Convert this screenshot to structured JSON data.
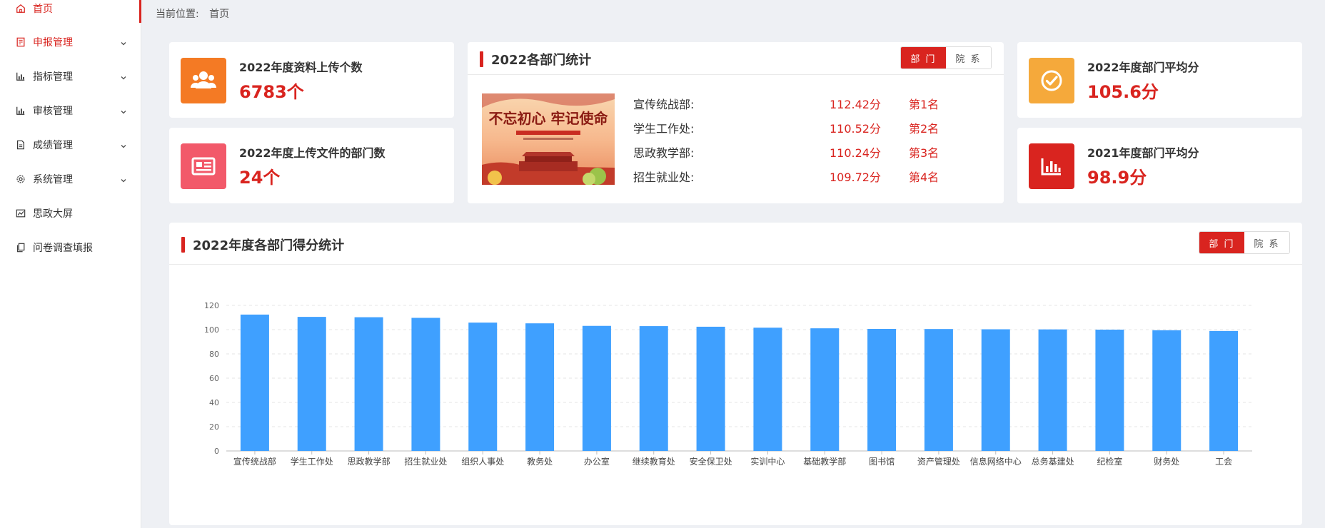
{
  "sidebar": {
    "items": [
      {
        "label": "首页",
        "icon": "home-icon",
        "active": true,
        "expandable": false
      },
      {
        "label": "申报管理",
        "icon": "form-icon",
        "active": false,
        "expandable": true
      },
      {
        "label": "指标管理",
        "icon": "bar-chart-icon",
        "active": false,
        "expandable": true
      },
      {
        "label": "审核管理",
        "icon": "bar-chart-icon",
        "active": false,
        "expandable": true
      },
      {
        "label": "成绩管理",
        "icon": "document-icon",
        "active": false,
        "expandable": true
      },
      {
        "label": "系统管理",
        "icon": "gear-icon",
        "active": false,
        "expandable": true
      },
      {
        "label": "思政大屏",
        "icon": "line-chart-icon",
        "active": false,
        "expandable": false
      },
      {
        "label": "问卷调查填报",
        "icon": "copy-icon",
        "active": false,
        "expandable": false
      }
    ]
  },
  "breadcrumb": {
    "prefix": "当前位置:",
    "current": "首页"
  },
  "stats": {
    "upload_count": {
      "label": "2022年度资料上传个数",
      "value": "6783个",
      "color": "#f47a24",
      "icon": "users-icon"
    },
    "dept_count": {
      "label": "2022年度上传文件的部门数",
      "value": "24个",
      "color": "#f2596a",
      "icon": "newspaper-icon"
    },
    "avg_2022": {
      "label": "2022年度部门平均分",
      "value": "105.6分",
      "color": "#f5a93b",
      "icon": "check-circle-icon"
    },
    "avg_2021": {
      "label": "2021年度部门平均分",
      "value": "98.9分",
      "color": "#d9241f",
      "icon": "stats-icon"
    }
  },
  "ranking": {
    "title": "2022各部门统计",
    "toggle": {
      "dept": "部 门",
      "college": "院 系"
    },
    "poster_text": "不忘初心 牢记使命",
    "rows": [
      {
        "dept": "宣传统战部:",
        "score": "112.42分",
        "rank": "第1名"
      },
      {
        "dept": "学生工作处:",
        "score": "110.52分",
        "rank": "第2名"
      },
      {
        "dept": "思政教学部:",
        "score": "110.24分",
        "rank": "第3名"
      },
      {
        "dept": "招生就业处:",
        "score": "109.72分",
        "rank": "第4名"
      }
    ]
  },
  "score_panel": {
    "title": "2022年度各部门得分统计",
    "toggle": {
      "dept": "部 门",
      "college": "院 系"
    }
  },
  "chart_data": {
    "type": "bar",
    "categories": [
      "宣传统战部",
      "学生工作处",
      "思政教学部",
      "招生就业处",
      "组织人事处",
      "教务处",
      "办公室",
      "继续教育处",
      "安全保卫处",
      "实训中心",
      "基础教学部",
      "图书馆",
      "资产管理处",
      "信息网络中心",
      "总务基建处",
      "纪检室",
      "财务处",
      "工会"
    ],
    "values": [
      112.42,
      110.52,
      110.24,
      109.72,
      105.8,
      105.2,
      103.1,
      102.9,
      102.4,
      101.6,
      101.1,
      100.6,
      100.5,
      100.3,
      100.2,
      100.0,
      99.5,
      98.9
    ],
    "ylim": [
      0,
      120
    ],
    "yticks": [
      0,
      20,
      40,
      60,
      80,
      100,
      120
    ],
    "bar_color": "#3fa0ff",
    "grid": true
  },
  "colors": {
    "accent": "#d9241f",
    "bar": "#3fa0ff"
  }
}
